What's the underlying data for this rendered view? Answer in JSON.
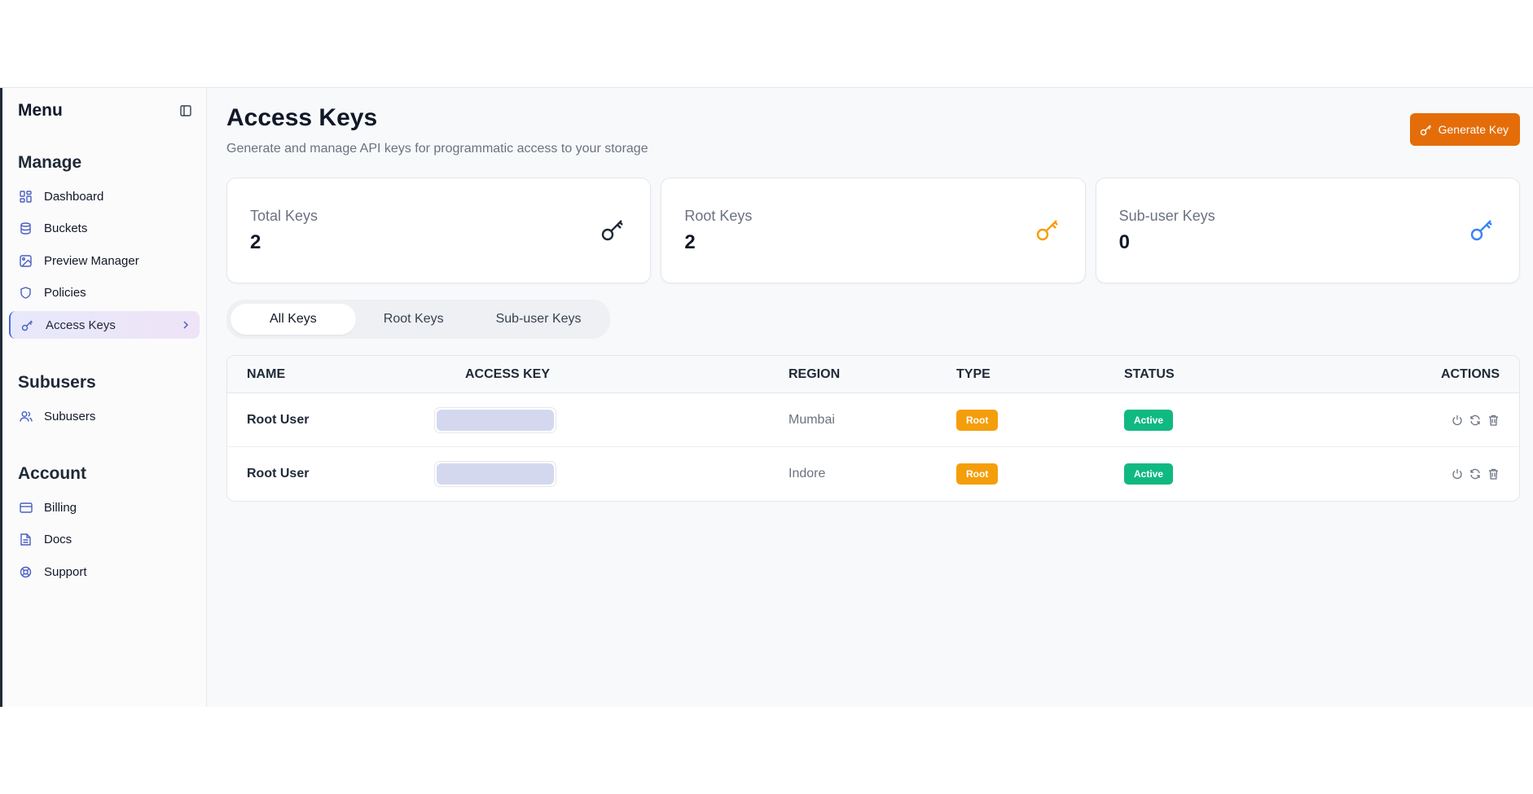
{
  "sidebar": {
    "title": "Menu",
    "sections": [
      {
        "title": "Manage",
        "items": [
          {
            "label": "Dashboard",
            "icon": "dashboard-icon"
          },
          {
            "label": "Buckets",
            "icon": "database-icon"
          },
          {
            "label": "Preview Manager",
            "icon": "image-icon"
          },
          {
            "label": "Policies",
            "icon": "shield-icon"
          },
          {
            "label": "Access Keys",
            "icon": "key-icon",
            "active": true
          }
        ]
      },
      {
        "title": "Subusers",
        "items": [
          {
            "label": "Subusers",
            "icon": "users-icon"
          }
        ]
      },
      {
        "title": "Account",
        "items": [
          {
            "label": "Billing",
            "icon": "credit-card-icon"
          },
          {
            "label": "Docs",
            "icon": "document-icon"
          },
          {
            "label": "Support",
            "icon": "lifebuoy-icon"
          }
        ]
      }
    ]
  },
  "header": {
    "title": "Access Keys",
    "subtitle": "Generate and manage API keys for programmatic access to your storage",
    "generate_label": "Generate Key"
  },
  "cards": [
    {
      "label": "Total Keys",
      "value": "2",
      "icon_color": "#1f2937"
    },
    {
      "label": "Root Keys",
      "value": "2",
      "icon_color": "#f59e0b"
    },
    {
      "label": "Sub-user Keys",
      "value": "0",
      "icon_color": "#3b82f6"
    }
  ],
  "tabs": [
    "All Keys",
    "Root Keys",
    "Sub-user Keys"
  ],
  "table": {
    "headers": {
      "name": "NAME",
      "key": "ACCESS KEY",
      "region": "REGION",
      "type": "TYPE",
      "status": "STATUS",
      "actions": "ACTIONS"
    },
    "rows": [
      {
        "name": "Root User",
        "region": "Mumbai",
        "type": "Root",
        "status": "Active"
      },
      {
        "name": "Root User",
        "region": "Indore",
        "type": "Root",
        "status": "Active"
      }
    ]
  },
  "colors": {
    "accent": "#e46d09",
    "root_badge": "#f59e0b",
    "active_badge": "#10b981",
    "active_nav_border": "#4f67d8"
  }
}
